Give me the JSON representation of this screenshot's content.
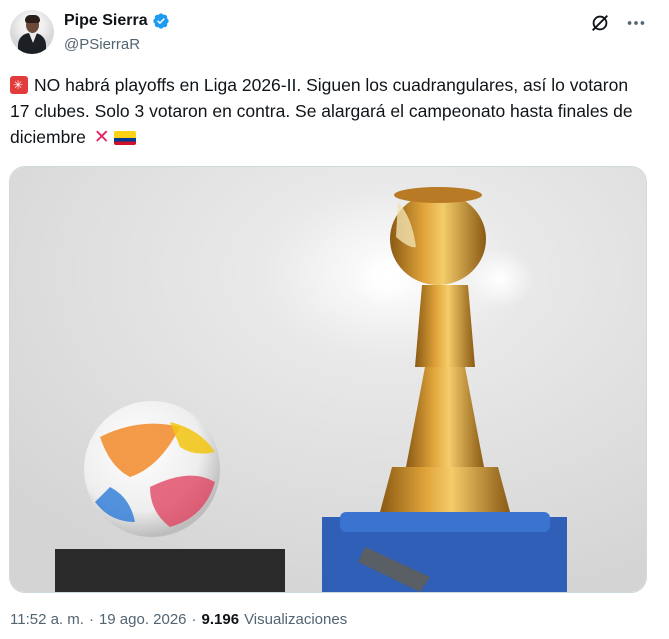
{
  "author": {
    "display_name": "Pipe Sierra",
    "handle": "@PSierraR",
    "verified": true,
    "avatar_icon": "avatar-icon"
  },
  "actions": {
    "grok_icon": "grok-icon",
    "more_icon": "more-icon"
  },
  "tweet": {
    "lead_icon": "siren-icon",
    "text": "NO habrá playoffs en Liga 2026-II. Siguen los cuadrangulares, así lo votaron 17 clubes. Solo 3 votaron en contra. Se alargará el campeonato hasta finales de diciembre",
    "trailing_icons": [
      "cross-mark-icon",
      "colombia-flag-icon"
    ]
  },
  "media": {
    "type": "photo",
    "subjects": [
      "match-ball",
      "trophy"
    ]
  },
  "meta": {
    "time": "11:52 a. m.",
    "separator": "·",
    "date": "19 ago. 2026",
    "separator2": "·",
    "views_count": "9.196",
    "views_label": "Visualizaciones"
  },
  "colors": {
    "text": "#0f1419",
    "secondary": "#536471",
    "verified": "#1d9bf0",
    "border": "#cfd9de"
  }
}
